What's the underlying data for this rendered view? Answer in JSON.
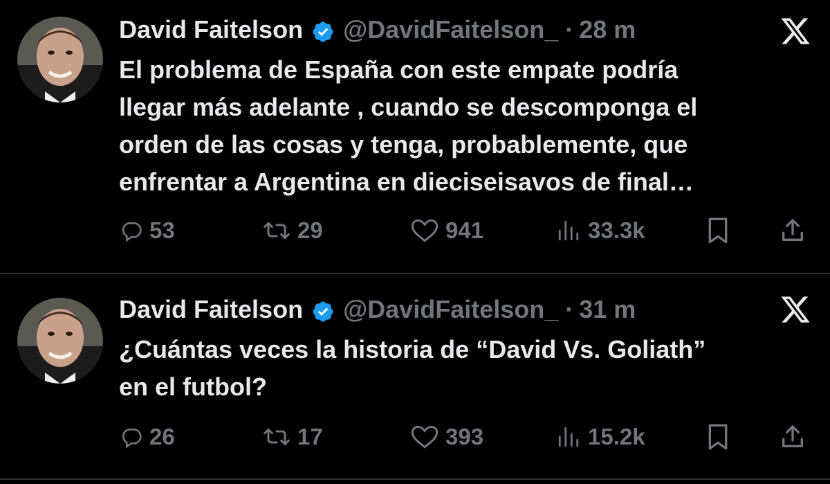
{
  "colors": {
    "background": "#000000",
    "text_primary": "#e7e9ea",
    "text_secondary": "#71767b",
    "verified_blue": "#1d9bf0",
    "divider": "#2f3336"
  },
  "tweets": [
    {
      "author_name": "David Faitelson",
      "handle": "@DavidFaitelson_",
      "separator": "·",
      "time": "28 m",
      "text": "El problema de España con este empate podría\nllegar más adelante , cuando se descomponga el\norden de las cosas y tenga, probablemente, que\nenfrentar a Argentina en dieciseisavos de final…",
      "replies": "53",
      "retweets": "29",
      "likes": "941",
      "views": "33.3k"
    },
    {
      "author_name": "David Faitelson",
      "handle": "@DavidFaitelson_",
      "separator": "·",
      "time": "31 m",
      "text": "¿Cuántas veces la historia de “David Vs. Goliath”\nen el futbol?",
      "replies": "26",
      "retweets": "17",
      "likes": "393",
      "views": "15.2k"
    }
  ],
  "icons": {
    "platform_logo": "x-logo-icon",
    "verified": "verified-badge-icon",
    "reply": "reply-icon",
    "retweet": "retweet-icon",
    "like": "heart-icon",
    "views": "views-icon",
    "bookmark": "bookmark-icon",
    "share": "share-icon"
  }
}
